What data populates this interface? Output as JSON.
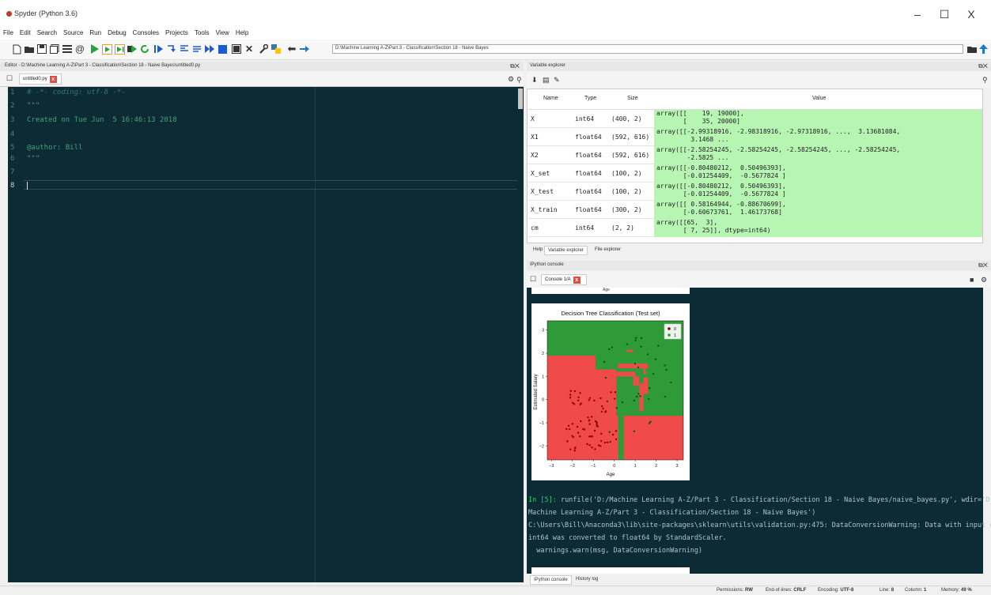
{
  "window": {
    "title": "Spyder (Python 3.6)",
    "controls": [
      "–",
      "☐",
      "X"
    ]
  },
  "menu": [
    "File",
    "Edit",
    "Search",
    "Source",
    "Run",
    "Debug",
    "Consoles",
    "Projects",
    "Tools",
    "View",
    "Help"
  ],
  "toolbar": {
    "path": "D:\\Machine Learning A-Z\\Part 3 - Classification\\Section 18 - Naive Bayes"
  },
  "editor": {
    "title": "Editor - D:\\Machine Learning A-Z\\Part 3 - Classification\\Section 18 - Naive Bayes\\untitled0.py",
    "tab_label": "untitled0.py",
    "lines": [
      {
        "n": "1",
        "text": "# -*- coding: utf-8 -*-"
      },
      {
        "n": "2",
        "text": "\"\"\""
      },
      {
        "n": "3",
        "text": "Created on Tue Jun  5 16:46:13 2018"
      },
      {
        "n": "4",
        "text": ""
      },
      {
        "n": "5",
        "text": "@author: Bill"
      },
      {
        "n": "6",
        "text": "\"\"\""
      },
      {
        "n": "7",
        "text": ""
      },
      {
        "n": "8",
        "text": ""
      }
    ]
  },
  "variable_explorer": {
    "title": "Variable explorer",
    "headers": {
      "name": "Name",
      "type": "Type",
      "size": "Size",
      "value": "Value"
    },
    "rows": [
      {
        "name": "X",
        "type": "int64",
        "size": "(400, 2)",
        "value": "array([[    19, 19000],\n       [    35, 20000]"
      },
      {
        "name": "X1",
        "type": "float64",
        "size": "(592, 616)",
        "value": "array([[-2.99318916, -2.98318916, -2.97318916, ...,  3.13681084,\n         3.1468 ..."
      },
      {
        "name": "X2",
        "type": "float64",
        "size": "(592, 616)",
        "value": "array([[-2.58254245, -2.58254245, -2.58254245, ..., -2.58254245,\n        -2.5825 ..."
      },
      {
        "name": "X_set",
        "type": "float64",
        "size": "(100, 2)",
        "value": "array([[-0.80480212,  0.50496393],\n       [-0.01254409,  -0.5677824 ]"
      },
      {
        "name": "X_test",
        "type": "float64",
        "size": "(100, 2)",
        "value": "array([[-0.80480212,  0.50496393],\n       [-0.01254409,  -0.5677824 ]"
      },
      {
        "name": "X_train",
        "type": "float64",
        "size": "(300, 2)",
        "value": "array([[ 0.58164944, -0.88670699],\n       [-0.60673761,  1.46173768]"
      },
      {
        "name": "cm",
        "type": "int64",
        "size": "(2, 2)",
        "value": "array([[65,  3],\n       [ 7, 25]], dtype=int64)"
      }
    ],
    "tabs": [
      "Help",
      "Variable explorer",
      "File explorer"
    ]
  },
  "console": {
    "title": "IPython console",
    "tab_label": "Console 1/A",
    "plot": {
      "title": "Decision Tree Classification (Test set)",
      "xlabel": "Age",
      "ylabel": "Estimated Salary",
      "xticks": [
        "−3",
        "−2",
        "−1",
        "0",
        "1",
        "2",
        "3"
      ],
      "yticks": [
        "3",
        "2",
        "1",
        "0",
        "−1",
        "−2"
      ],
      "legend": [
        "0",
        "1"
      ],
      "colors": {
        "red": "#f04a4a",
        "green": "#2e9b38",
        "dark_red": "#8b0000",
        "dark_green": "#005a00"
      }
    },
    "top_label": "Age",
    "in_prompt": "In [5]:",
    "lines": [
      " runfile('D:/Machine Learning A-Z/Part 3 - Classification/Section 18 - Naive Bayes/naive_bayes.py', wdir='D:/",
      "Machine Learning A-Z/Part 3 - Classification/Section 18 - Naive Bayes')",
      "C:\\Users\\Bill\\Anaconda3\\lib\\site-packages\\sklearn\\utils\\validation.py:475: DataConversionWarning: Data with input dtype",
      "int64 was converted to float64 by StandardScaler.",
      "  warnings.warn(msg, DataConversionWarning)"
    ],
    "bottom_tabs": [
      "IPython console",
      "History log"
    ]
  },
  "status": {
    "permissions_label": "Permissions:",
    "permissions": "RW",
    "eol_label": "End-of-lines:",
    "eol": "CRLF",
    "encoding_label": "Encoding:",
    "encoding": "UTF-8",
    "line_label": "Line:",
    "line": "8",
    "column_label": "Column:",
    "column": "1",
    "memory_label": "Memory:",
    "memory": "49 %"
  }
}
